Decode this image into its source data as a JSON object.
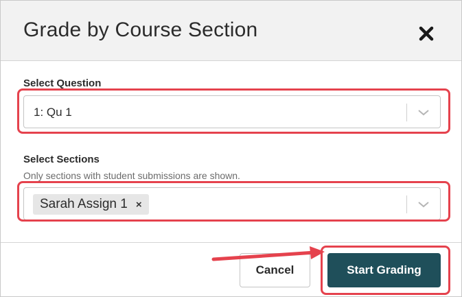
{
  "dialog": {
    "title": "Grade by Course Section",
    "close_icon": "close-icon"
  },
  "question_field": {
    "label": "Select Question",
    "value": "1: Qu 1"
  },
  "sections_field": {
    "label": "Select Sections",
    "help_text": "Only sections with student submissions are shown.",
    "chips": [
      {
        "label": "Sarah Assign 1",
        "remove_glyph": "×"
      }
    ]
  },
  "footer": {
    "cancel_label": "Cancel",
    "start_label": "Start Grading"
  },
  "colors": {
    "accent": "#1f4f5a",
    "annotation": "#e5424d",
    "header_bg": "#f2f2f2"
  },
  "icons": {
    "close": "close-icon",
    "dropdown": "chevron-down-icon",
    "remove": "remove-chip-icon",
    "annotation_arrow": "arrow-right-icon"
  }
}
